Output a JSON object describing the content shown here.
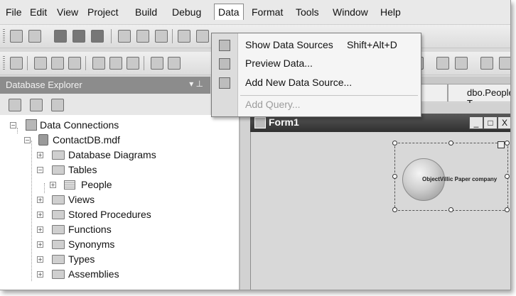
{
  "menu": {
    "items": [
      "File",
      "Edit",
      "View",
      "Project",
      "Build",
      "Debug",
      "Data",
      "Format",
      "Tools",
      "Window",
      "Help"
    ],
    "active": "Data"
  },
  "data_menu": {
    "show_data_sources": "Show Data Sources",
    "show_data_sources_shortcut": "Shift+Alt+D",
    "preview_data": "Preview Data...",
    "add_new_data_source": "Add New Data Source...",
    "add_query": "Add Query..."
  },
  "database_explorer": {
    "title": "Database Explorer",
    "pin": "▾ ⊥",
    "tree": {
      "root": "Data Connections",
      "db": "ContactDB.mdf",
      "diagrams": "Database Diagrams",
      "tables": "Tables",
      "people": "People",
      "views": "Views",
      "stored_procedures": "Stored Procedures",
      "functions": "Functions",
      "synonyms": "Synonyms",
      "types": "Types",
      "assemblies": "Assemblies"
    }
  },
  "designer": {
    "tab": "dbo.People: T...",
    "form_title": "Form1",
    "form_min": "_",
    "form_max": "□",
    "form_close": "X",
    "logo_text": "ObjectVillic Paper company"
  }
}
